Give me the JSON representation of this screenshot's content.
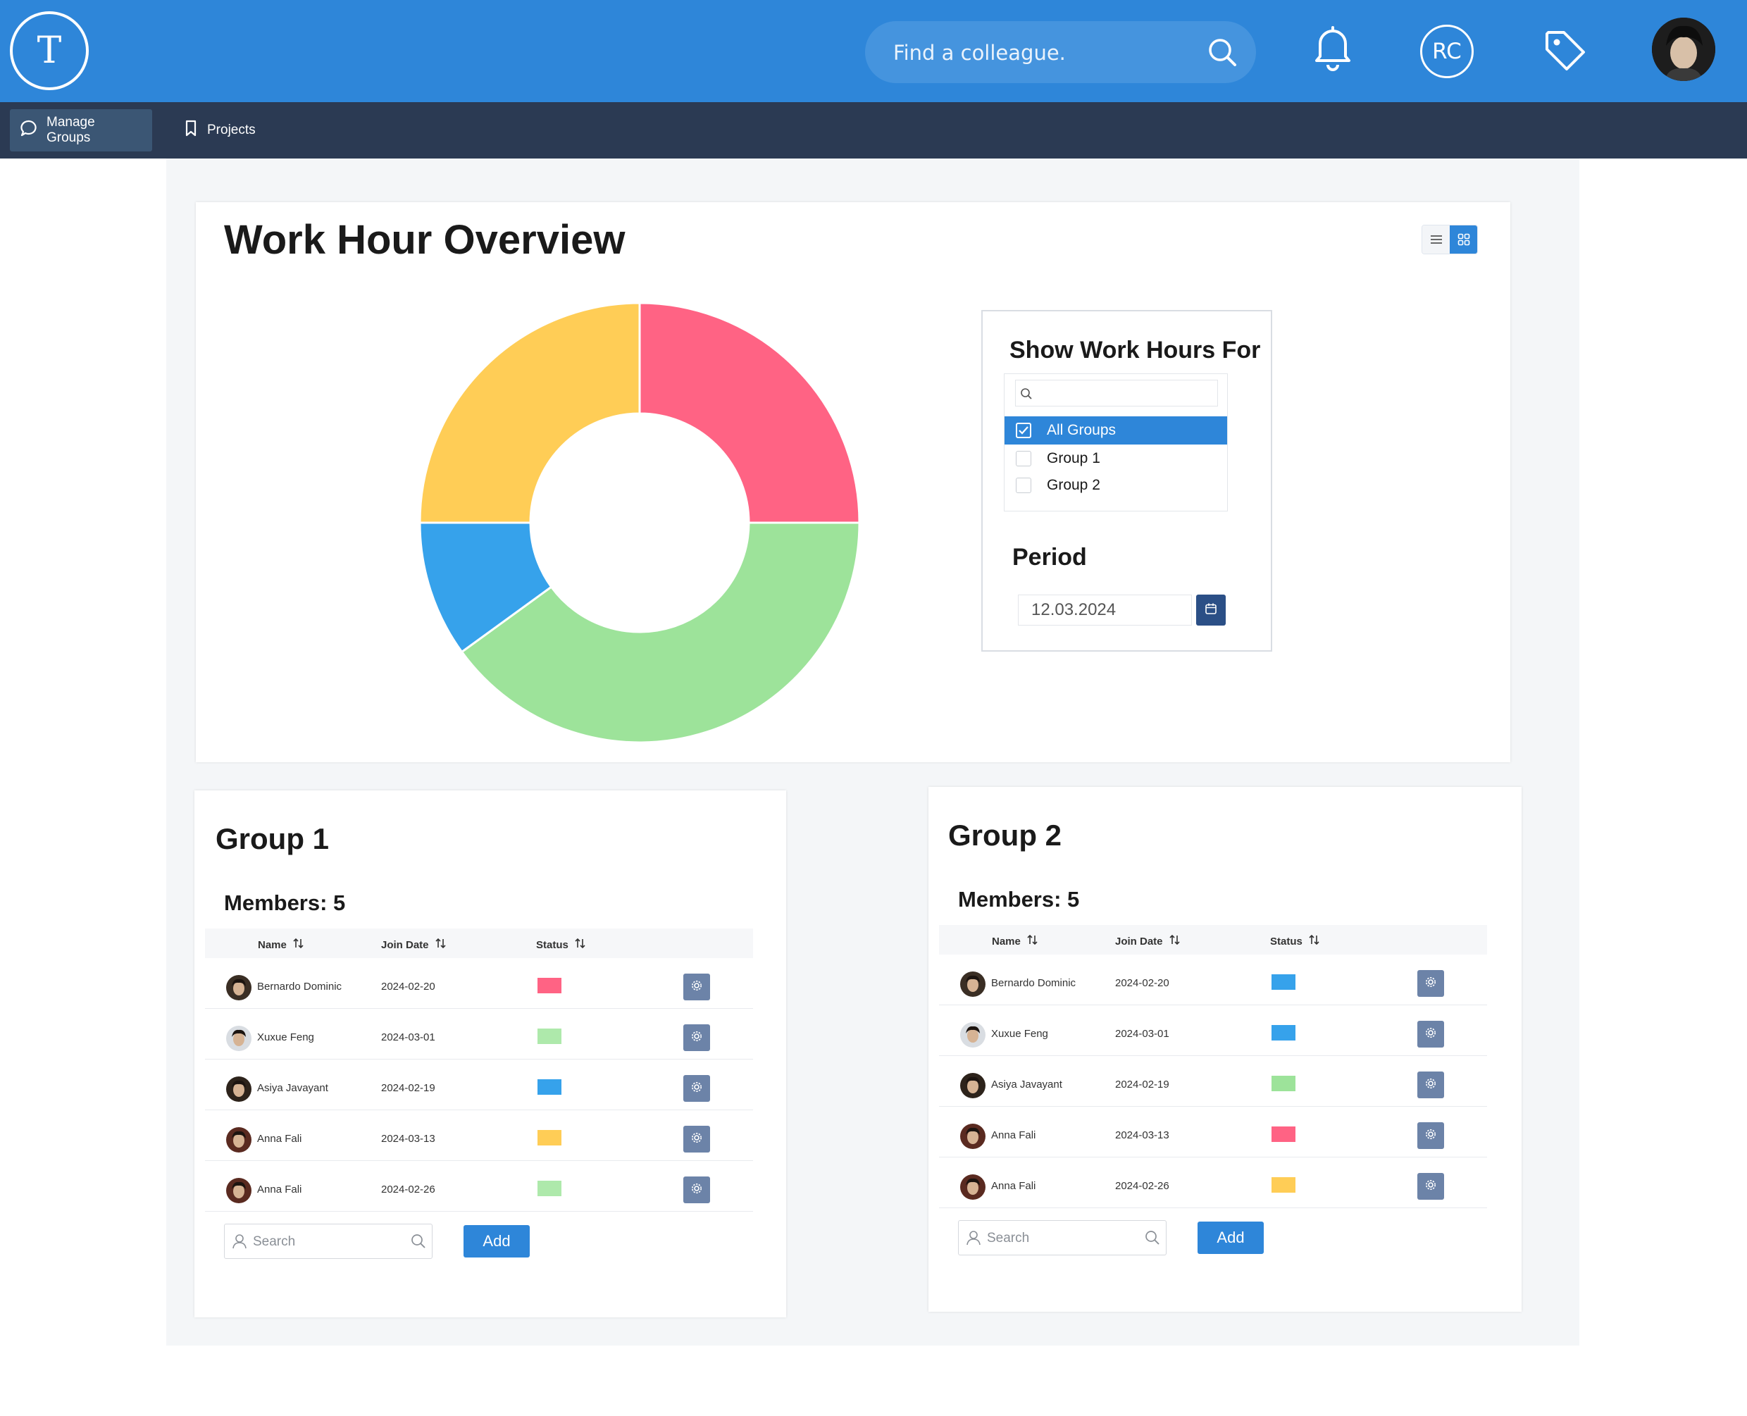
{
  "header": {
    "logo_letter": "T",
    "search_placeholder": "Find a colleague.",
    "user_initials": "RC"
  },
  "nav": {
    "items": [
      {
        "label": "Manage Groups",
        "icon": "chat-bubble-icon",
        "active": true
      },
      {
        "label": "Projects",
        "icon": "bookmark-icon",
        "active": false
      }
    ]
  },
  "overview": {
    "title": "Work Hour Overview",
    "chart_data": {
      "type": "pie",
      "donut": true,
      "slices": [
        {
          "color": "#ff6384",
          "value": 25
        },
        {
          "color": "#9de39a",
          "value": 40
        },
        {
          "color": "#36a2eb",
          "value": 10
        },
        {
          "color": "#ffcd56",
          "value": 25
        }
      ]
    },
    "filter": {
      "title": "Show Work Hours For",
      "options": [
        {
          "label": "All Groups",
          "checked": true
        },
        {
          "label": "Group 1",
          "checked": false
        },
        {
          "label": "Group 2",
          "checked": false
        }
      ],
      "period_title": "Period",
      "period_value": "12.03.2024"
    }
  },
  "groups": [
    {
      "title": "Group 1",
      "members_label": "Members: 5",
      "columns": [
        "Name",
        "Join Date",
        "Status"
      ],
      "rows": [
        {
          "name": "Bernardo Dominic",
          "join_date": "2024-02-20",
          "status_color": "#ff6384"
        },
        {
          "name": "Xuxue Feng",
          "join_date": "2024-03-01",
          "status_color": "#aee9ab"
        },
        {
          "name": "Asiya Javayant",
          "join_date": "2024-02-19",
          "status_color": "#36a2eb"
        },
        {
          "name": "Anna Fali",
          "join_date": "2024-03-13",
          "status_color": "#ffcd56"
        },
        {
          "name": "Anna Fali",
          "join_date": "2024-02-26",
          "status_color": "#aee9ab"
        }
      ],
      "search_placeholder": "Search",
      "add_label": "Add"
    },
    {
      "title": "Group  2",
      "members_label": "Members: 5",
      "columns": [
        "Name",
        "Join Date",
        "Status"
      ],
      "rows": [
        {
          "name": "Bernardo Dominic",
          "join_date": "2024-02-20",
          "status_color": "#36a2eb"
        },
        {
          "name": "Xuxue Feng",
          "join_date": "2024-03-01",
          "status_color": "#36a2eb"
        },
        {
          "name": "Asiya Javayant",
          "join_date": "2024-02-19",
          "status_color": "#9de39a"
        },
        {
          "name": "Anna Fali",
          "join_date": "2024-03-13",
          "status_color": "#ff6384"
        },
        {
          "name": "Anna Fali",
          "join_date": "2024-02-26",
          "status_color": "#ffcd56"
        }
      ],
      "search_placeholder": "Search",
      "add_label": "Add"
    }
  ]
}
